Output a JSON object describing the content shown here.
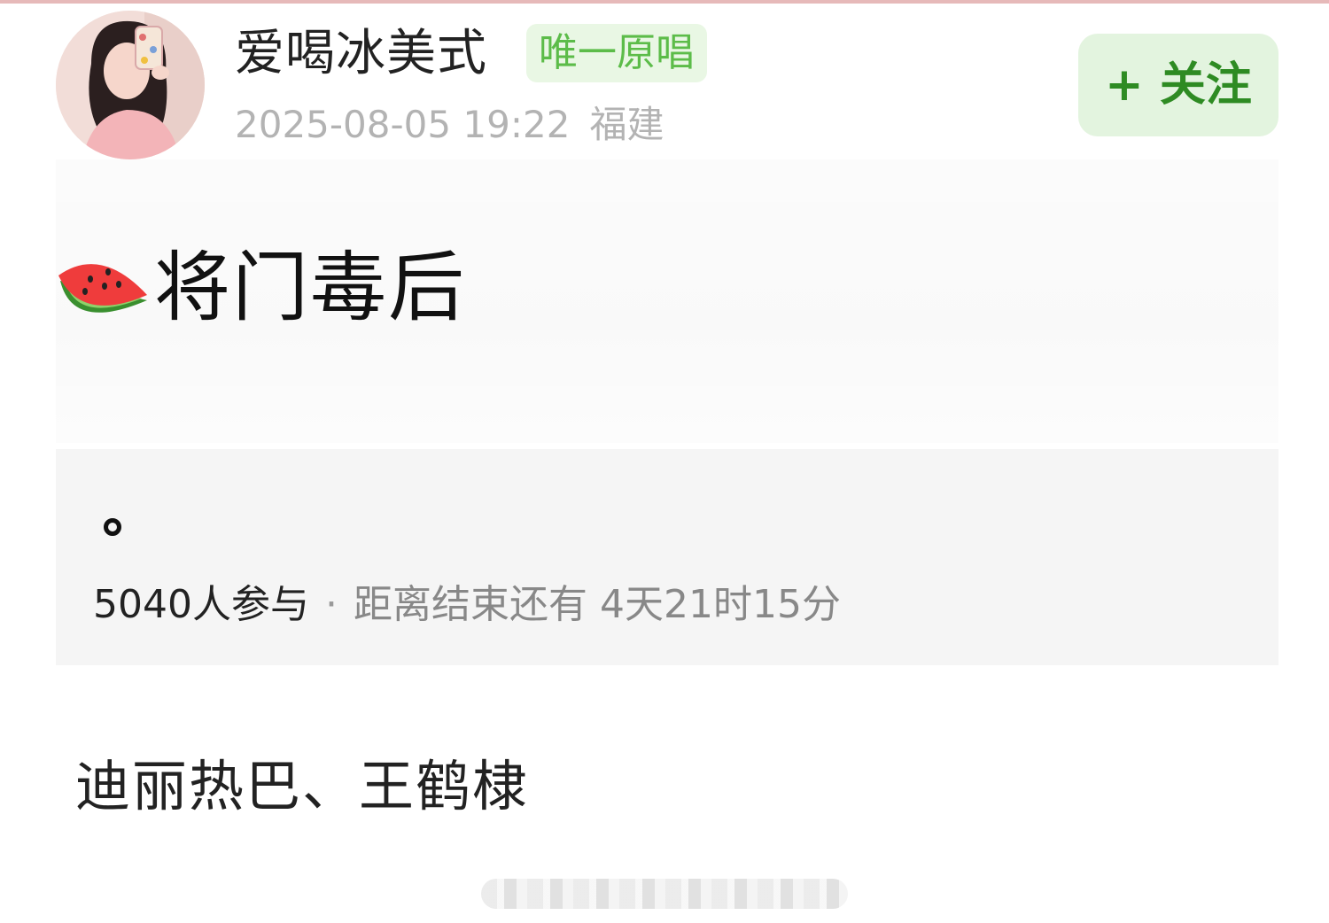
{
  "header": {
    "username": "爱喝冰美式",
    "badge": "唯一原唱",
    "timestamp": "2025-08-05 19:22",
    "location": "福建",
    "follow_label": "+ 关注"
  },
  "post": {
    "title_icon": "watermelon-icon",
    "title": "将门毒后",
    "poll": {
      "option_mark": "。",
      "participants": "5040人参与",
      "separator": "·",
      "time_remaining": "距离结束还有 4天21时15分"
    },
    "body": "迪丽热巴、王鹤棣"
  },
  "colors": {
    "badge_text": "#5cbc49",
    "badge_bg": "#e9f7e4",
    "follow_text": "#2e8b23",
    "follow_bg": "#e3f4df",
    "poll_bg": "#f5f5f5"
  }
}
